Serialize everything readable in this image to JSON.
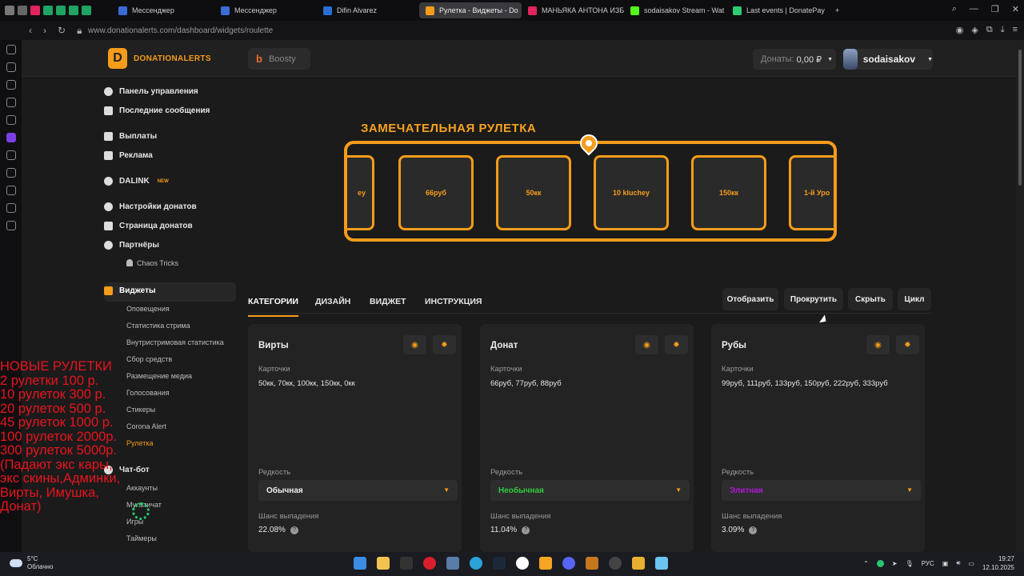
{
  "browser": {
    "tabs": [
      {
        "label": "Мессенджер",
        "color": "#3b6bd6"
      },
      {
        "label": "Мессенджер",
        "color": "#3b6bd6"
      },
      {
        "label": "Difin Alvarez",
        "color": "#2a6fd1"
      },
      {
        "label": "Рулетка - Виджеты - Do",
        "color": "#f59c1a",
        "active": true
      },
      {
        "label": "МАНЬЯКА АНТОНА ИЗБ",
        "color": "#e0245e"
      },
      {
        "label": "sodaisakov Stream - Wat",
        "color": "#53fc18"
      },
      {
        "label": "Last events | DonatePay",
        "color": "#2ecc71"
      }
    ],
    "url": "www.donationalerts.com/dashboard/widgets/roulette"
  },
  "header": {
    "logo_text": "DONATIONALERTS",
    "boosty_label": "Boosty",
    "donats_label": "Донаты:",
    "donats_value": "0,00 ₽",
    "username": "sodaisakov"
  },
  "sidebar": {
    "items": [
      {
        "label": "Панель управления"
      },
      {
        "label": "Последние сообщения"
      },
      {
        "label": "Выплаты"
      },
      {
        "label": "Реклама"
      },
      {
        "label": "DALINK",
        "badge": "NEW"
      },
      {
        "label": "Настройки донатов"
      },
      {
        "label": "Страница донатов"
      },
      {
        "label": "Партнёры"
      },
      {
        "label": "Виджеты"
      },
      {
        "label": "Чат-бот"
      }
    ],
    "partners_sub": [
      "Chaos Tricks"
    ],
    "widgets_sub": [
      "Оповещения",
      "Статистика стрима",
      "Внутристримовая статистика",
      "Сбор средств",
      "Размещение медиа",
      "Голосования",
      "Стикеры",
      "Corona Alert",
      "Рулетка"
    ],
    "chatbot_sub": [
      "Аккаунты",
      "Мультичат",
      "Игры",
      "Таймеры"
    ]
  },
  "overlay_text": "НОВЫЕ РУЛЕТКИ\n2 рулетки 100 р.\n10 рулеток  300 р.\n20 рулеток 500 р.\n45 рулеток 1000 р.\n100 рулеток 2000р.\n300 рулеток 5000р.\n(Падают экс кары,\nэкс скины,Админки,\nВирты, Имушка,\nДонат)",
  "roulette": {
    "title": "ЗАМЕЧАТЕЛЬНАЯ РУЛЕТКА",
    "cards": [
      "ey",
      "66руб",
      "50кк",
      "10 kluchey",
      "150кк",
      "1-й Уро"
    ]
  },
  "tabs": {
    "items": [
      "КАТЕГОРИИ",
      "ДИЗАЙН",
      "ВИДЖЕТ",
      "ИНСТРУКЦИЯ"
    ],
    "active": 0
  },
  "actions": [
    "Отобразить",
    "Прокрутить",
    "Скрыть",
    "Цикл"
  ],
  "categories": [
    {
      "title": "Вирты",
      "cards_label": "Карточки",
      "cards": "50кк, 70кк, 100кк, 150кк, 0кк",
      "rarity_label": "Редкость",
      "rarity": "Обычная",
      "rarity_color": "#eeeeee",
      "chance_label": "Шанс выпадения",
      "chance": "22.08%"
    },
    {
      "title": "Донат",
      "cards_label": "Карточки",
      "cards": "66руб, 77руб, 88руб",
      "rarity_label": "Редкость",
      "rarity": "Необычная",
      "rarity_color": "#2ecc40",
      "chance_label": "Шанс выпадения",
      "chance": "11.04%"
    },
    {
      "title": "Рубы",
      "cards_label": "Карточки",
      "cards": "99руб, 111руб, 133руб, 150руб, 222руб, 333руб",
      "rarity_label": "Редкость",
      "rarity": "Элитная",
      "rarity_color": "#b318d9",
      "chance_label": "Шанс выпадения",
      "chance": "3.09%"
    }
  ],
  "taskbar": {
    "temp": "5°C",
    "weather": "Облачно",
    "lang": "РУС",
    "time": "19:27",
    "date": "12.10.2025"
  }
}
